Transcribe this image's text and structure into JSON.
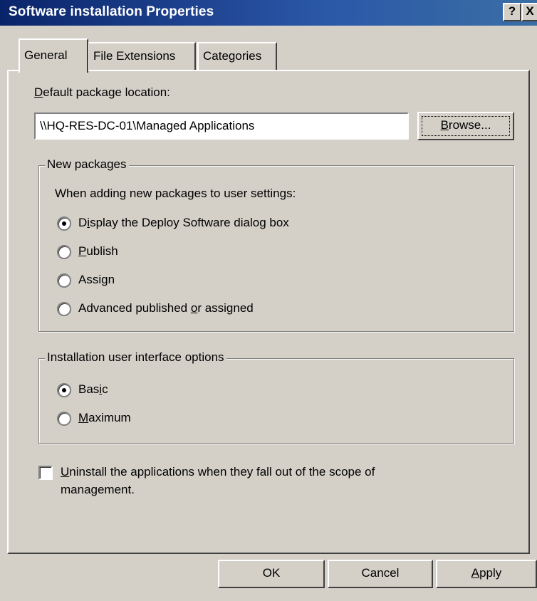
{
  "window": {
    "title": "Software installation Properties",
    "help_glyph": "?",
    "close_glyph": "X"
  },
  "tabs": [
    {
      "label": "General"
    },
    {
      "label": "File Extensions"
    },
    {
      "label": "Categories"
    }
  ],
  "general": {
    "location_label_accel": "D",
    "location_label_rest": "efault package location:",
    "location_value": "\\\\HQ-RES-DC-01\\Managed Applications",
    "browse_label_accel": "B",
    "browse_label_rest": "rowse...",
    "new_packages": {
      "title": "New packages",
      "description": "When adding new packages to user settings:",
      "options": [
        {
          "pre": "D",
          "accel": "i",
          "post": "splay the Deploy Software dialog box",
          "checked": true
        },
        {
          "pre": "",
          "accel": "P",
          "post": "ublish",
          "checked": false
        },
        {
          "pre": "Assi",
          "accel": "g",
          "post": "n",
          "checked": false
        },
        {
          "pre": "Advanced published ",
          "accel": "o",
          "post": "r assigned",
          "checked": false
        }
      ]
    },
    "ui_options": {
      "title": "Installation user interface options",
      "options": [
        {
          "pre": "Bas",
          "accel": "i",
          "post": "c",
          "checked": true
        },
        {
          "pre": "",
          "accel": "M",
          "post": "aximum",
          "checked": false
        }
      ]
    },
    "uninstall": {
      "accel": "U",
      "line1_rest": "ninstall the applications when they fall out of the scope of",
      "line2": "management.",
      "checked": false
    }
  },
  "buttons": {
    "ok": "OK",
    "cancel": "Cancel",
    "apply_accel": "A",
    "apply_rest": "pply"
  }
}
